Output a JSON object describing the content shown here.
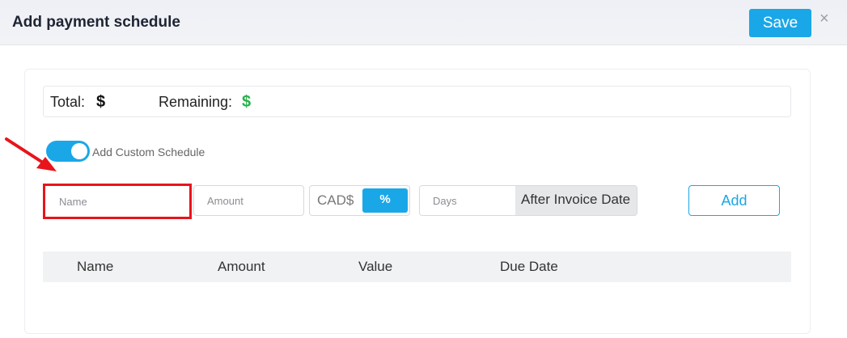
{
  "header": {
    "title": "Add payment schedule",
    "save_label": "Save",
    "close_glyph": "×"
  },
  "totals": {
    "total_label": "Total:",
    "total_symbol": "$",
    "remaining_label": "Remaining:",
    "remaining_symbol": "$"
  },
  "custom_schedule": {
    "label": "Add Custom Schedule",
    "enabled": true
  },
  "form": {
    "name_placeholder": "Name",
    "amount_placeholder": "Amount",
    "unit_options": [
      "CAD$",
      "%"
    ],
    "unit_selected": "%",
    "days_placeholder": "Days",
    "days_suffix": "After Invoice Date",
    "add_label": "Add"
  },
  "table": {
    "columns": [
      "Name",
      "Amount",
      "Value",
      "Due Date"
    ],
    "rows": []
  },
  "colors": {
    "accent": "#1aa7e8",
    "remaining_symbol": "#27b24a",
    "highlight": "#e8141c"
  },
  "icons": {
    "close": "close-icon",
    "annotation_arrow": "arrow-icon"
  }
}
